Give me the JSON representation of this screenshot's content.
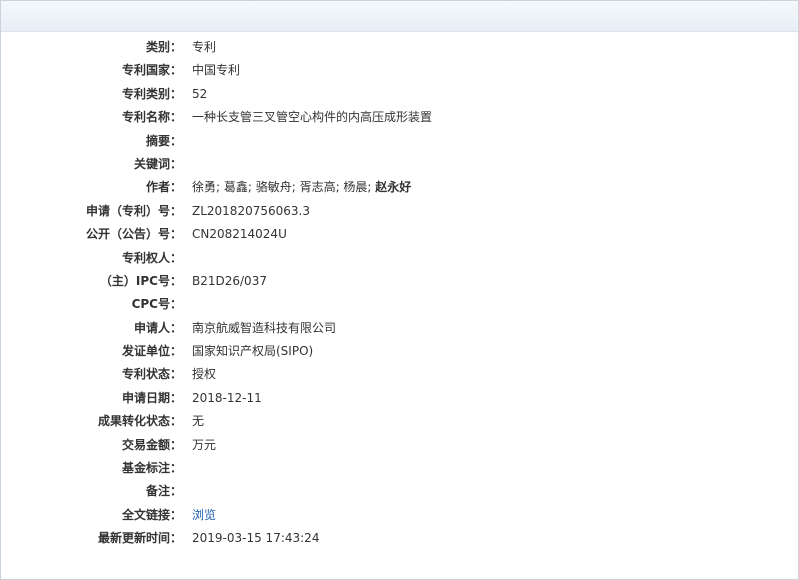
{
  "fields": [
    {
      "label": "类别：",
      "value": "专利"
    },
    {
      "label": "专利国家：",
      "value": "中国专利"
    },
    {
      "label": "专利类别：",
      "value": "52"
    },
    {
      "label": "专利名称：",
      "value": "一种长支管三叉管空心构件的内高压成形装置"
    },
    {
      "label": "摘要：",
      "value": ""
    },
    {
      "label": "关键词：",
      "value": ""
    },
    {
      "label": "作者：",
      "value": "徐勇; 葛鑫; 骆敏舟; 胥志高; 杨晨; ",
      "value_bold": "赵永好"
    },
    {
      "label": "申请（专利）号：",
      "value": "ZL201820756063.3"
    },
    {
      "label": "公开（公告）号：",
      "value": "CN208214024U"
    },
    {
      "label": "专利权人：",
      "value": ""
    },
    {
      "label": "（主）IPC号：",
      "value": "B21D26/037"
    },
    {
      "label": "CPC号：",
      "value": ""
    },
    {
      "label": "申请人：",
      "value": "南京航威智造科技有限公司"
    },
    {
      "label": "发证单位：",
      "value": "国家知识产权局(SIPO)"
    },
    {
      "label": "专利状态：",
      "value": "授权"
    },
    {
      "label": "申请日期：",
      "value": "2018-12-11"
    },
    {
      "label": "成果转化状态：",
      "value": "无"
    },
    {
      "label": "交易金额：",
      "value": "万元"
    },
    {
      "label": "基金标注：",
      "value": ""
    },
    {
      "label": "备注：",
      "value": ""
    },
    {
      "label": "全文链接：",
      "value": "",
      "link": "浏览"
    },
    {
      "label": "最新更新时间：",
      "value": "2019-03-15 17:43:24"
    }
  ],
  "colors": {
    "link": "#1d5fb0",
    "text": "#333333",
    "border": "#c9d3dd"
  }
}
